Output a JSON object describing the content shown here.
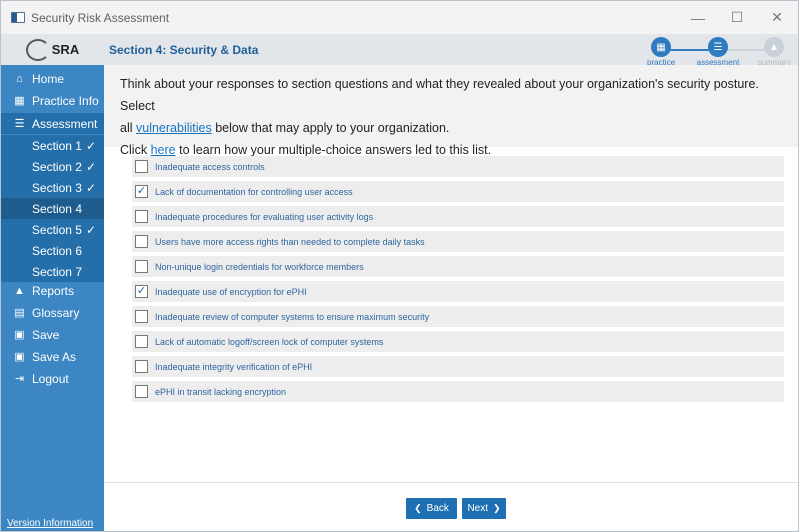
{
  "window": {
    "title": "Security Risk Assessment",
    "minimize_icon": "—",
    "maximize_icon": "☐",
    "close_icon": "✕"
  },
  "logo": {
    "text": "SRA"
  },
  "sidebar": {
    "items": [
      {
        "label": "Home",
        "icon": "home-icon",
        "glyph": "⌂"
      },
      {
        "label": "Practice Info",
        "icon": "practice-icon",
        "glyph": "▦"
      },
      {
        "label": "Assessment",
        "icon": "assessment-icon",
        "glyph": "☰"
      },
      {
        "label": "Reports",
        "icon": "reports-icon",
        "glyph": "▲"
      },
      {
        "label": "Glossary",
        "icon": "glossary-icon",
        "glyph": "▤"
      },
      {
        "label": "Save",
        "icon": "save-icon",
        "glyph": "▣"
      },
      {
        "label": "Save As",
        "icon": "save-as-icon",
        "glyph": "▣"
      },
      {
        "label": "Logout",
        "icon": "logout-icon",
        "glyph": "⇥"
      }
    ],
    "sections": [
      {
        "label": "Section 1",
        "check": "✓"
      },
      {
        "label": "Section 2",
        "check": "✓"
      },
      {
        "label": "Section 3",
        "check": "✓"
      },
      {
        "label": "Section 4",
        "check": ""
      },
      {
        "label": "Section 5",
        "check": "✓"
      },
      {
        "label": "Section 6",
        "check": ""
      },
      {
        "label": "Section 7",
        "check": ""
      }
    ],
    "version_info": "Version Information"
  },
  "header": {
    "title": "Section 4: Security & Data",
    "steps": [
      {
        "label": "practice",
        "state": "active"
      },
      {
        "label": "assessment",
        "state": "active"
      },
      {
        "label": "summary",
        "state": "inactive"
      }
    ]
  },
  "intro": {
    "line1": "Think about your responses to section questions and what they revealed about your organization's security posture. Select",
    "line2_pre": "all",
    "line2_link": "vulnerabilities",
    "line2_post": "below that may apply to your organization.",
    "line3_pre": "Click",
    "line3_link": "here",
    "line3_post": "to learn how your multiple-choice answers led to this list."
  },
  "vulnerabilities": [
    {
      "label": "Inadequate access controls",
      "checked": false
    },
    {
      "label": "Lack of documentation for controlling user access",
      "checked": true
    },
    {
      "label": "Inadequate procedures for evaluating user activity logs",
      "checked": false
    },
    {
      "label": "Users have more access rights than needed to complete daily tasks",
      "checked": false
    },
    {
      "label": "Non-unique login credentials for workforce members",
      "checked": false
    },
    {
      "label": "Inadequate use of encryption for ePHI",
      "checked": true
    },
    {
      "label": "Inadequate review of computer systems to ensure maximum security",
      "checked": false
    },
    {
      "label": "Lack of automatic logoff/screen lock of computer systems",
      "checked": false
    },
    {
      "label": "Inadequate integrity verification of ePHI",
      "checked": false
    },
    {
      "label": "ePHI in transit lacking encryption",
      "checked": false
    }
  ],
  "footer": {
    "back_label": "Back",
    "back_icon": "❮",
    "next_label": "Next",
    "next_icon": "❯"
  },
  "colors": {
    "sidebar": "#3b86c3",
    "accent": "#1f6fb5",
    "header_bg": "#e2e6ea"
  }
}
